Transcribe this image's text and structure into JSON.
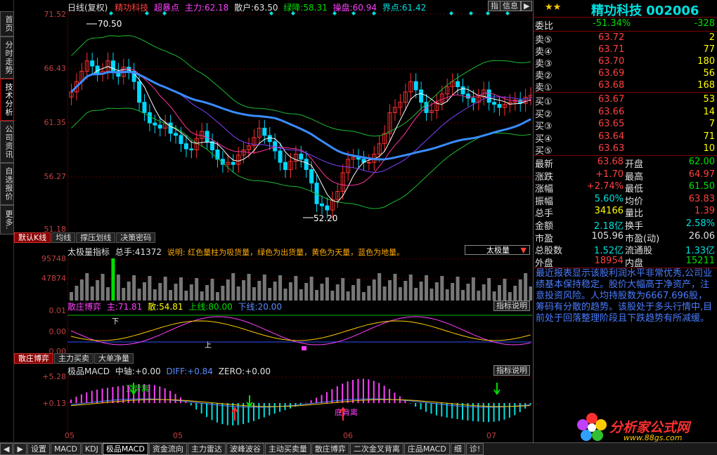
{
  "left_tabs": [
    "首页",
    "分时走势",
    "技术分析",
    "公司资讯",
    "自选报价",
    "更多."
  ],
  "kline": {
    "header": {
      "mode": "日线(复权)",
      "name": "精功科技",
      "indicator": "超暴点",
      "zl_label": "主力:",
      "zl_val": "62.18",
      "sh_label": "散户:",
      "sh_val": "63.50",
      "lj_label": "绿降:",
      "lj_val": "58.31",
      "cp_label": "操盘:",
      "cp_val": "60.94",
      "jd_label": "界点:",
      "jd_val": "61.42"
    },
    "top_buttons": [
      "指",
      "信息",
      "▶"
    ],
    "yaxis": [
      "71.52",
      "66.43",
      "61.35",
      "56.27",
      "51.18"
    ],
    "hi_label": "70.50",
    "lo_label": "52.20",
    "tabs": [
      "默认K线",
      "均线",
      "撑压划线",
      "决策密码"
    ]
  },
  "vol": {
    "name": "太极量指标",
    "total_label": "总手:",
    "total_val": "41372",
    "desc": "说明: 红色量柱为吸货量，绿色为出货量，黄色为天量，蓝色为地量。",
    "select": "太极量",
    "yaxis": [
      "95748",
      "47874"
    ]
  },
  "sz": {
    "name": "散庄博弈",
    "zhu_label": "主:",
    "zhu_val": "71.81",
    "san_label": "散:",
    "san_val": "54.81",
    "up_label": "上线:",
    "up_val": "80.00",
    "dn_label": "下线:",
    "dn_val": "20.00",
    "help": "指标说明",
    "yaxis": [
      "0.01",
      "0.00",
      "0.00"
    ],
    "mark1": "下",
    "mark2": "上",
    "tabs": [
      "散庄博弈",
      "主力买卖",
      "大单净量"
    ]
  },
  "macd": {
    "name": "极品MACD",
    "mid_label": "中轴:",
    "mid_val": "+0.00",
    "diff_label": "DIFF:",
    "diff_val": "+0.84",
    "zero_label": "ZERO:",
    "zero_val": "+0.00",
    "help": "指标说明",
    "yaxis": [
      "+5.28",
      "+0.13"
    ],
    "ann1": "顶背离",
    "ann2": "底背离",
    "xaxis": [
      "05",
      "05",
      "06",
      "07"
    ]
  },
  "quote": {
    "stars": "★★",
    "title": "精功科技 002006",
    "wb_label": "委比",
    "wb_pct": "-51.34%",
    "wb_val": "-328",
    "sells": [
      {
        "label": "卖⑤",
        "price": "63.72",
        "vol": "2"
      },
      {
        "label": "卖④",
        "price": "63.71",
        "vol": "77"
      },
      {
        "label": "卖③",
        "price": "63.70",
        "vol": "180"
      },
      {
        "label": "卖②",
        "price": "63.69",
        "vol": "56"
      },
      {
        "label": "卖①",
        "price": "63.68",
        "vol": "168"
      }
    ],
    "buys": [
      {
        "label": "买①",
        "price": "63.67",
        "vol": "53"
      },
      {
        "label": "买②",
        "price": "63.66",
        "vol": "14"
      },
      {
        "label": "买③",
        "price": "63.65",
        "vol": "7"
      },
      {
        "label": "买④",
        "price": "63.64",
        "vol": "71"
      },
      {
        "label": "买⑤",
        "price": "63.63",
        "vol": "10"
      }
    ],
    "stats": [
      {
        "l1": "最新",
        "v1": "63.68",
        "c1": "red",
        "l2": "开盘",
        "v2": "62.00",
        "c2": "grn"
      },
      {
        "l1": "涨跌",
        "v1": "+1.70",
        "c1": "red",
        "l2": "最高",
        "v2": "64.97",
        "c2": "red"
      },
      {
        "l1": "涨幅",
        "v1": "+2.74%",
        "c1": "red",
        "l2": "最低",
        "v2": "61.50",
        "c2": "grn"
      },
      {
        "l1": "振幅",
        "v1": "5.60%",
        "c1": "cyan",
        "l2": "均价",
        "v2": "63.83",
        "c2": "red"
      },
      {
        "l1": "总手",
        "v1": "34166",
        "c1": "yel",
        "l2": "量比",
        "v2": "1.39",
        "c2": "red"
      },
      {
        "l1": "金额",
        "v1": "2.18亿",
        "c1": "cyan",
        "l2": "换手",
        "v2": "2.58%",
        "c2": "cyan"
      },
      {
        "l1": "市盈",
        "v1": "105.96",
        "c1": "wht",
        "l2": "市盈(动)",
        "v2": "26.06",
        "c2": "wht"
      },
      {
        "l1": "总股数",
        "v1": "1.52亿",
        "c1": "cyan",
        "l2": "流通股",
        "v2": "1.33亿",
        "c2": "cyan"
      },
      {
        "l1": "外盘",
        "v1": "18954",
        "c1": "red",
        "l2": "内盘",
        "v2": "15211",
        "c2": "grn"
      }
    ],
    "comment": "最近报表显示该股利润水平非常优秀,公司业绩基本保持稳定。股价大幅高于净资产，注意投资风险。人均持股数为6667.696股，筹码有分散的趋势。该股处于多头行情中,目前处于回落整理阶段且下跌趋势有所减缓。",
    "logo_text": "分析家公式网",
    "logo_url": "www.88gs.com"
  },
  "bottom_tabs": [
    "◀",
    "▶",
    "设置",
    "MACD",
    "KDJ",
    "极品MACD",
    "资金流向",
    "主力雷达",
    "波峰波谷",
    "主动买卖量",
    "散庄博弈",
    "二次金叉背离",
    "庄品MACD",
    "细",
    "诊!"
  ]
}
